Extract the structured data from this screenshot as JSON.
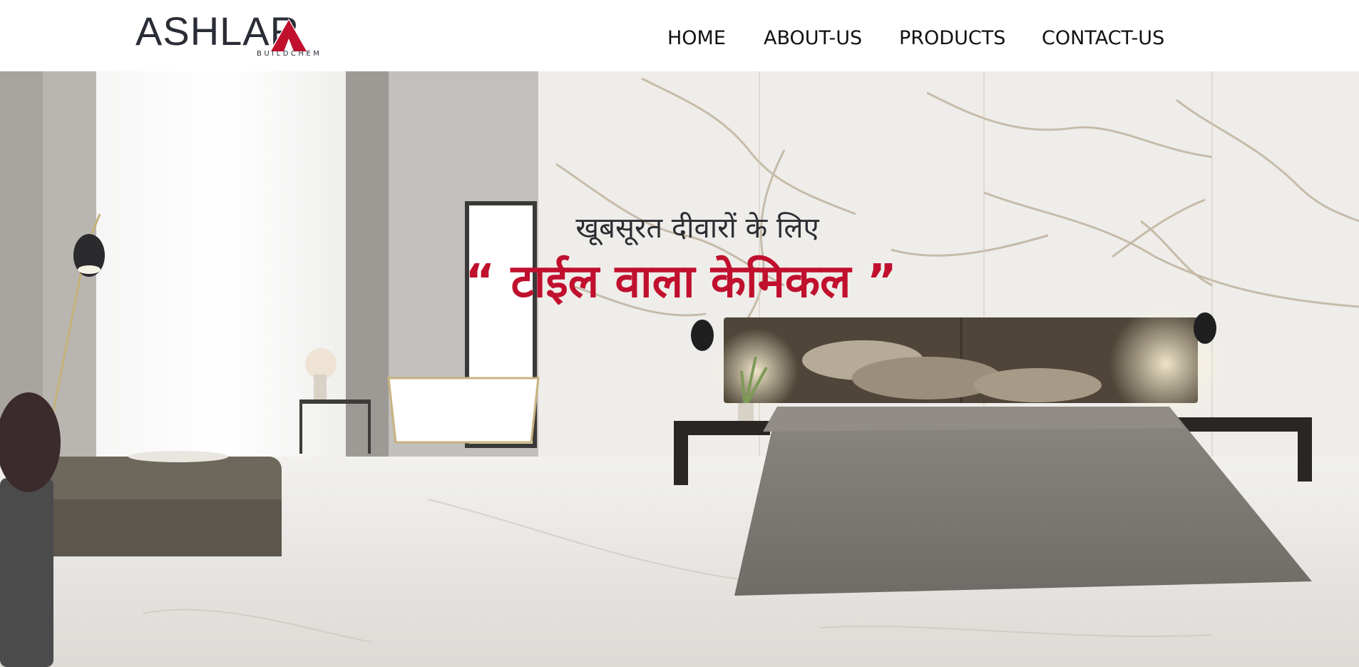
{
  "brand": {
    "name": "ASHLAR",
    "tagline": "BUILDCHEM",
    "colors": {
      "primary": "#2a2d36",
      "accent": "#c0102e"
    }
  },
  "nav": {
    "items": [
      {
        "label": "HOME"
      },
      {
        "label": "ABOUT-US"
      },
      {
        "label": "PRODUCTS"
      },
      {
        "label": "CONTACT-US"
      }
    ]
  },
  "hero": {
    "subtitle": "खूबसूरत दीवारों के लिए",
    "title": "“ टाईल वाला केमिकल ”",
    "background": "marble-bedroom-photo"
  }
}
